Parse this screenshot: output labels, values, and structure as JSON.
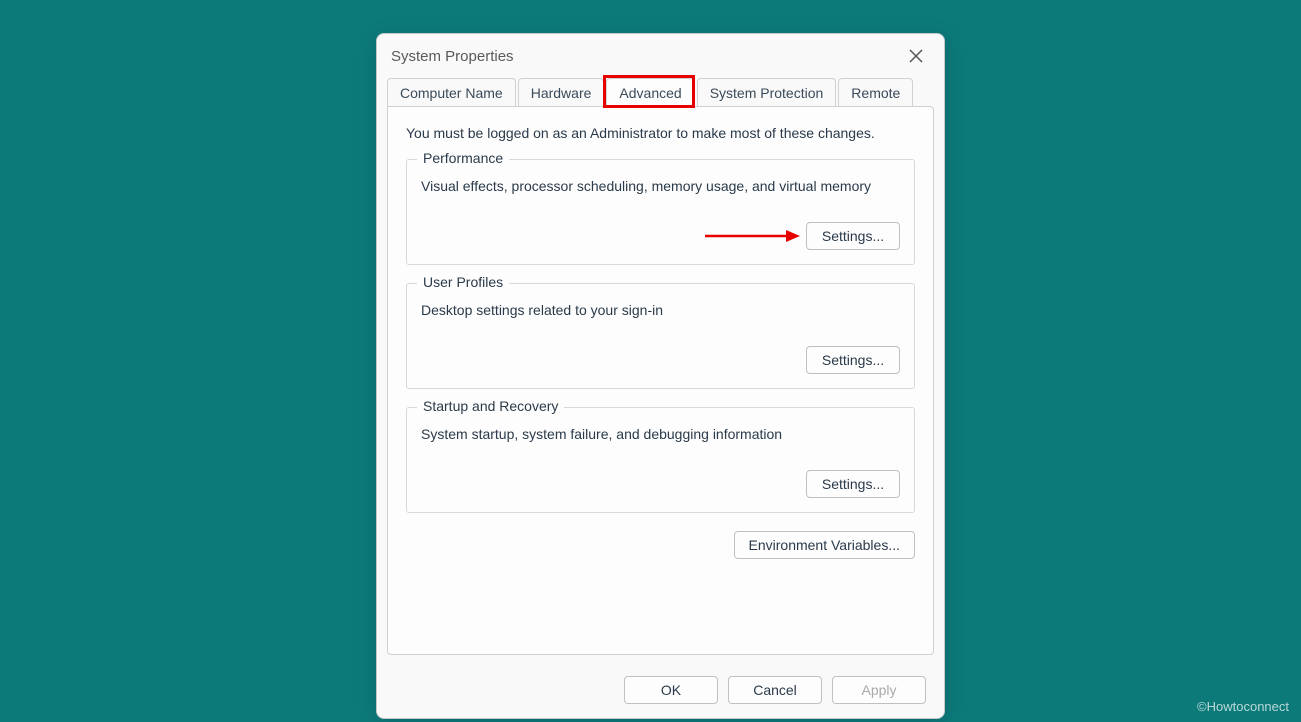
{
  "window": {
    "title": "System Properties"
  },
  "tabs": {
    "computer_name": "Computer Name",
    "hardware": "Hardware",
    "advanced": "Advanced",
    "system_protection": "System Protection",
    "remote": "Remote"
  },
  "content": {
    "intro": "You must be logged on as an Administrator to make most of these changes.",
    "performance": {
      "title": "Performance",
      "desc": "Visual effects, processor scheduling, memory usage, and virtual memory",
      "button": "Settings..."
    },
    "user_profiles": {
      "title": "User Profiles",
      "desc": "Desktop settings related to your sign-in",
      "button": "Settings..."
    },
    "startup_recovery": {
      "title": "Startup and Recovery",
      "desc": "System startup, system failure, and debugging information",
      "button": "Settings..."
    },
    "env_vars_button": "Environment Variables..."
  },
  "buttons": {
    "ok": "OK",
    "cancel": "Cancel",
    "apply": "Apply"
  },
  "watermark": "©Howtoconnect"
}
